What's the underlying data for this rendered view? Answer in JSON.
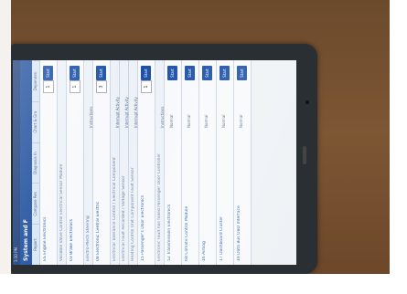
{
  "app": {
    "statusbar_text": "3:30 PM",
    "title": "System and F"
  },
  "tabs": [
    "Report",
    "Compare Res",
    "Diagnosis In",
    "Chart & Gra",
    "Dependen"
  ],
  "rows": [
    {
      "label": "ES Engine Electronics",
      "value": "",
      "stepper": "1",
      "button": "Start"
    },
    {
      "label": "Variable Valve Control Electrical Sensor Module",
      "value": "",
      "stepper": "",
      "button": "",
      "sub": true
    },
    {
      "label": "03 Brake Electronics",
      "value": "",
      "stepper": "1",
      "button": "Start"
    },
    {
      "label": "Electro-Mech Steering",
      "value": "Instructions",
      "stepper": "",
      "button": "",
      "sub": true
    },
    {
      "label": "08 Electronic Central Electric",
      "value": "",
      "stepper": "3",
      "button": "Start"
    },
    {
      "label": "Electrical Tolerance Control / Electrical Component",
      "value": "Interrupt Activity",
      "stepper": "",
      "button": "",
      "sub": true
    },
    {
      "label": "Electrical Fault Recorded / Voltage Sensor",
      "value": "Interrupt Activity",
      "stepper": "",
      "button": "",
      "sub": true
    },
    {
      "label": "Heating Control Unit Component Fault Sensor",
      "value": "Interrupt Activity",
      "stepper": "",
      "button": "",
      "sub": true
    },
    {
      "label": "15 Passenger's Door Electronics",
      "value": "",
      "stepper": "1",
      "button": "Start"
    },
    {
      "label": "Electronic Fault has failed Passenger Door Controller",
      "value": "Instructions",
      "stepper": "",
      "button": "",
      "sub": true
    },
    {
      "label": "52 Transmission Electronics",
      "value": "Normal",
      "stepper": "",
      "button": "Start"
    },
    {
      "label": "6B Climate Control Module",
      "value": "Normal",
      "stepper": "",
      "button": "Start"
    },
    {
      "label": "16 Airbag",
      "value": "Normal",
      "stepper": "",
      "button": "Start"
    },
    {
      "label": "17 Dashboard Cluster",
      "value": "Normal",
      "stepper": "",
      "button": "Start"
    },
    {
      "label": "19 Data Bus OBD Interface",
      "value": "Normal",
      "stepper": "",
      "button": "Start"
    }
  ]
}
